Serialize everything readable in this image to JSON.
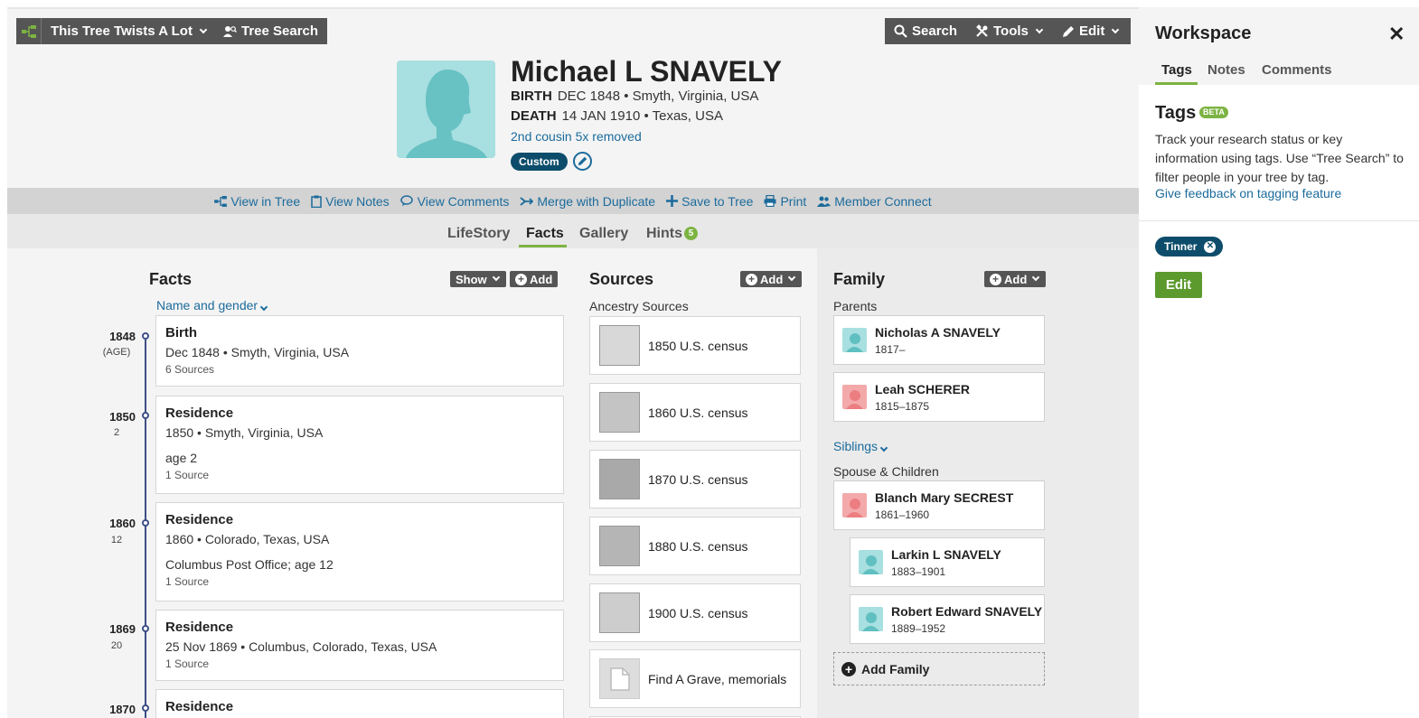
{
  "toolbar": {
    "tree_name": "This Tree Twists A Lot",
    "tree_search": "Tree Search",
    "search": "Search",
    "tools": "Tools",
    "edit": "Edit"
  },
  "person": {
    "name": "Michael L SNAVELY",
    "birth_label": "BIRTH",
    "birth_value": "DEC 1848 • Smyth, Virginia, USA",
    "death_label": "DEATH",
    "death_value": "14 JAN 1910 • Texas, USA",
    "relationship": "2nd cousin 5x removed",
    "badge": "Custom"
  },
  "actions": [
    "View in Tree",
    "View Notes",
    "View Comments",
    "Merge with Duplicate",
    "Save to Tree",
    "Print",
    "Member Connect"
  ],
  "page_tabs": {
    "lifestory": "LifeStory",
    "facts": "Facts",
    "gallery": "Gallery",
    "hints": "Hints",
    "hints_count": "5"
  },
  "facts": {
    "title": "Facts",
    "show": "Show",
    "add": "Add",
    "name_gender": "Name and gender",
    "items": [
      {
        "year": "1848",
        "age": "(AGE)",
        "title": "Birth",
        "line": "Dec 1848 • Smyth, Virginia, USA",
        "desc": "",
        "sources": "6 Sources"
      },
      {
        "year": "1850",
        "age": "2",
        "title": "Residence",
        "line": "1850 • Smyth, Virginia, USA",
        "desc": "age 2",
        "sources": "1 Source"
      },
      {
        "year": "1860",
        "age": "12",
        "title": "Residence",
        "line": "1860 • Colorado, Texas, USA",
        "desc": "Columbus Post Office; age 12",
        "sources": "1 Source"
      },
      {
        "year": "1869",
        "age": "20",
        "title": "Residence",
        "line": "25 Nov 1869 • Columbus, Colorado, Texas, USA",
        "desc": "",
        "sources": "1 Source"
      },
      {
        "year": "1870",
        "age": "",
        "title": "Residence",
        "line": "",
        "desc": "",
        "sources": ""
      }
    ]
  },
  "sources": {
    "title": "Sources",
    "add": "Add",
    "subtitle": "Ancestry Sources",
    "items": [
      "1850 U.S. census",
      "1860 U.S. census",
      "1870 U.S. census",
      "1880 U.S. census",
      "1900 U.S. census",
      "Find A Grave, memorials"
    ]
  },
  "family": {
    "title": "Family",
    "add": "Add",
    "parents_label": "Parents",
    "siblings_label": "Siblings",
    "spouse_label": "Spouse & Children",
    "add_family": "Add Family",
    "parents": [
      {
        "name": "Nicholas A SNAVELY",
        "dates": "1817–",
        "gender": "male"
      },
      {
        "name": "Leah SCHERER",
        "dates": "1815–1875",
        "gender": "female"
      }
    ],
    "spouse": {
      "name": "Blanch Mary SECREST",
      "dates": "1861–1960",
      "gender": "female"
    },
    "children": [
      {
        "name": "Larkin L SNAVELY",
        "dates": "1883–1901",
        "gender": "male"
      },
      {
        "name": "Robert Edward SNAVELY",
        "dates": "1889–1952",
        "gender": "male"
      }
    ]
  },
  "workspace": {
    "title": "Workspace",
    "close": "✕",
    "tabs": [
      "Tags",
      "Notes",
      "Comments"
    ],
    "tags_title": "Tags",
    "beta": "BETA",
    "description": "Track your research status or key information using tags. Use “Tree Search” to filter people in your tree by tag.",
    "feedback_link": "Give feedback on tagging feature",
    "tag": "Tinner",
    "edit": "Edit"
  },
  "colors": {
    "accent_green": "#7cb342",
    "link_blue": "#1b6b9c",
    "badge_navy": "#0d4d6b",
    "toolbar_gray": "#555555"
  }
}
